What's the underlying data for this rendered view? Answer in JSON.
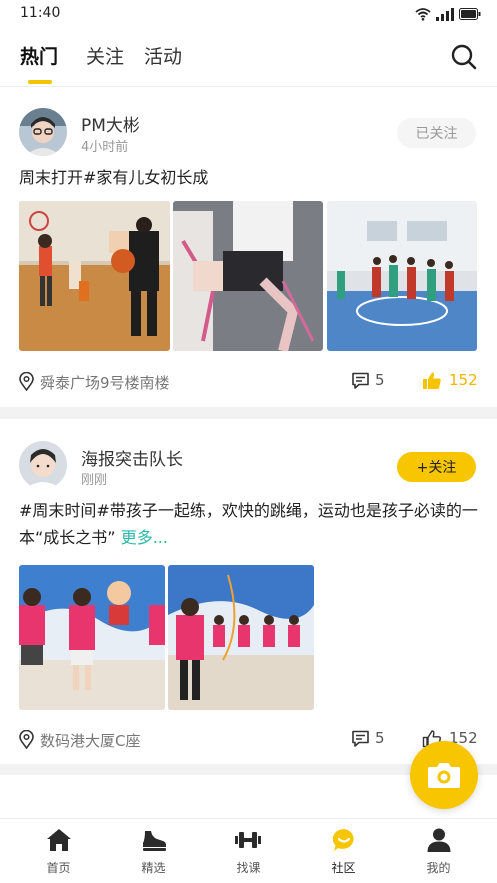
{
  "status_bar": {
    "time": "11:40"
  },
  "top_tabs": [
    {
      "label": "热门",
      "active": true
    },
    {
      "label": "关注",
      "active": false
    },
    {
      "label": "活动",
      "active": false
    }
  ],
  "posts": [
    {
      "username": "PM大彬",
      "time": "4小时前",
      "follow_label": "已关注",
      "text": "周末打开#家有儿女初长成",
      "more_label": "",
      "location": "舜泰广场9号楼南楼",
      "comments": "5",
      "likes": "152"
    },
    {
      "username": "海报突击队长",
      "time": "刚刚",
      "follow_label": "+关注",
      "text": "#周末时间#带孩子一起练，欢快的跳绳，运动也是孩子必读的一本“成长之书”",
      "more_label": "更多...",
      "location": "数码港大厦C座",
      "comments": "5",
      "likes": "152"
    }
  ],
  "bottom_nav": [
    {
      "label": "首页",
      "icon": "home-icon",
      "active": false
    },
    {
      "label": "精选",
      "icon": "shoe-icon",
      "active": false
    },
    {
      "label": "找课",
      "icon": "dumbbell-icon",
      "active": false
    },
    {
      "label": "社区",
      "icon": "chat-bubble-icon",
      "active": true
    },
    {
      "label": "我的",
      "icon": "person-icon",
      "active": false
    }
  ],
  "colors": {
    "accent": "#f7c600",
    "like_active": "#f5c400",
    "link": "#2bb8a8",
    "muted": "#999999"
  }
}
